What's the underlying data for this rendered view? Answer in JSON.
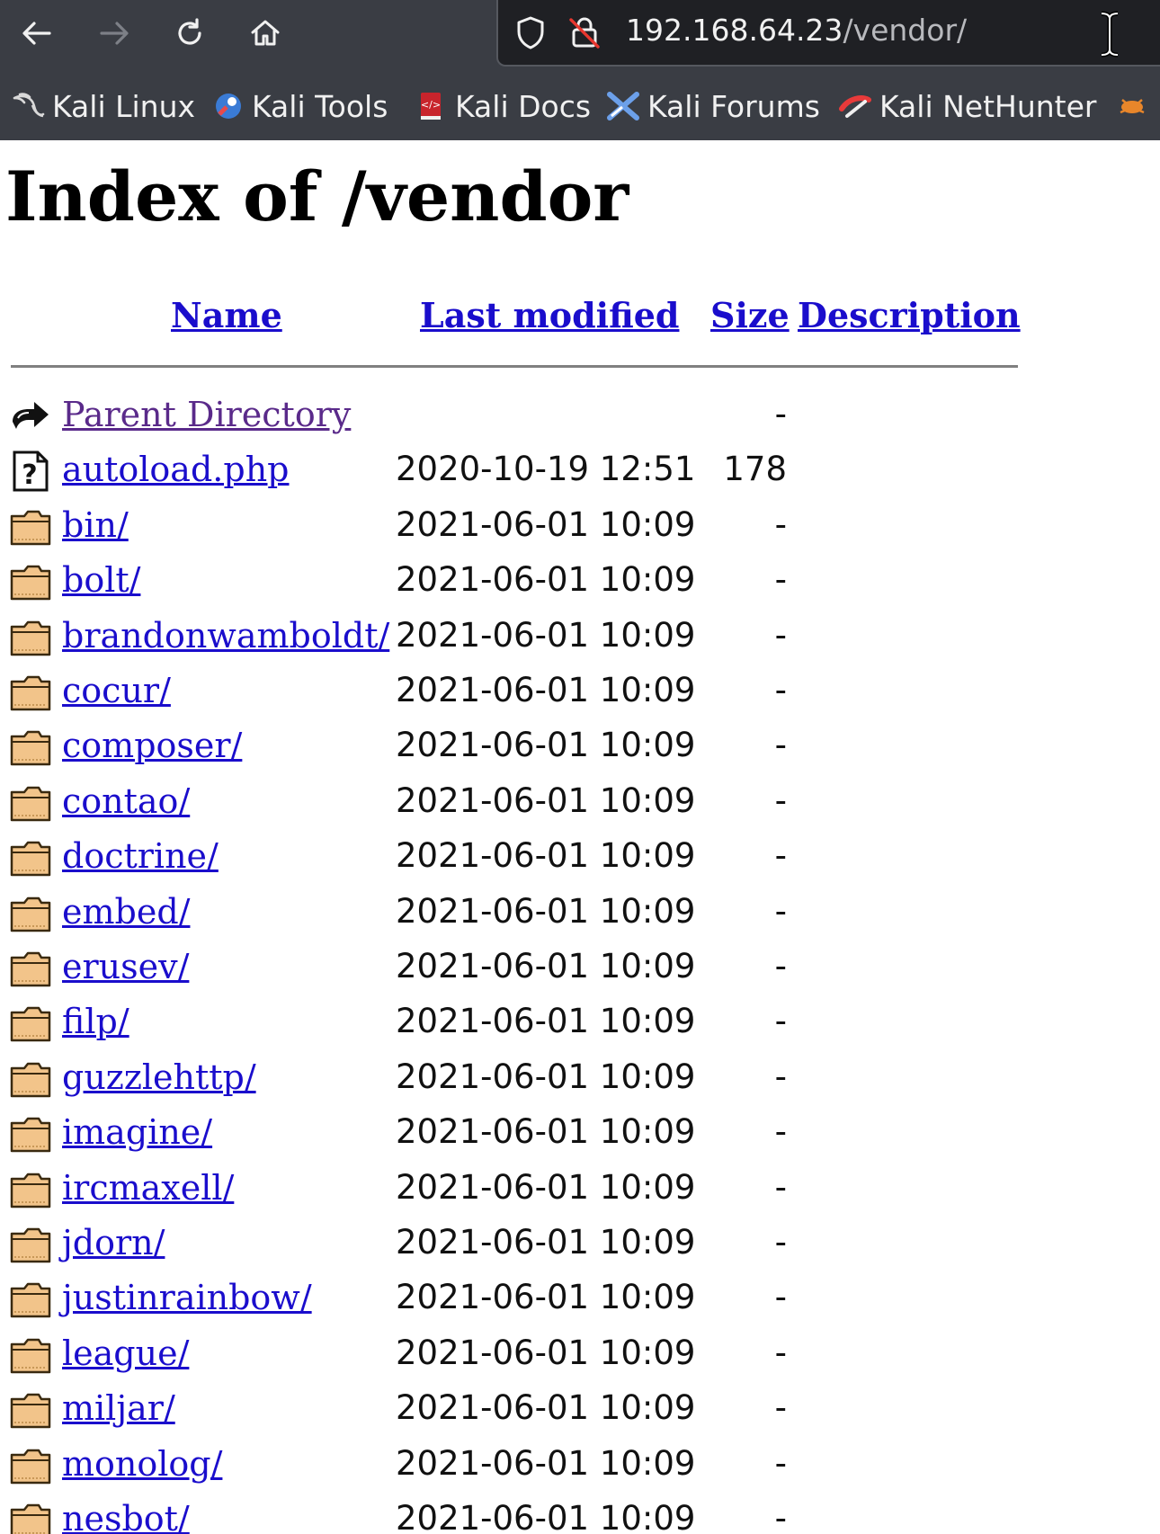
{
  "browser": {
    "url_host": "192.168.64.23",
    "url_path": "/vendor/",
    "icons": {
      "back": "arrow-left-icon",
      "forward": "arrow-right-icon",
      "reload": "reload-icon",
      "home": "home-icon",
      "shield": "shield-icon",
      "lock": "insecure-lock-icon"
    },
    "bookmarks": [
      {
        "label": "Kali Linux",
        "icon": "kali-dragon-icon"
      },
      {
        "label": "Kali Tools",
        "icon": "kali-tools-icon"
      },
      {
        "label": "Kali Docs",
        "icon": "kali-docs-icon"
      },
      {
        "label": "Kali Forums",
        "icon": "kali-forums-icon"
      },
      {
        "label": "Kali NetHunter",
        "icon": "kali-nethunter-icon"
      }
    ]
  },
  "page": {
    "title": "Index of /vendor",
    "columns": {
      "name": "Name",
      "last_modified": "Last modified",
      "size": "Size",
      "description": "Description"
    },
    "entries": [
      {
        "name": "Parent Directory",
        "date": "",
        "size": "-",
        "type": "parent"
      },
      {
        "name": "autoload.php",
        "date": "2020-10-19 12:51",
        "size": "178",
        "type": "file"
      },
      {
        "name": "bin/",
        "date": "2021-06-01 10:09",
        "size": "-",
        "type": "folder"
      },
      {
        "name": "bolt/",
        "date": "2021-06-01 10:09",
        "size": "-",
        "type": "folder"
      },
      {
        "name": "brandonwamboldt/",
        "date": "2021-06-01 10:09",
        "size": "-",
        "type": "folder"
      },
      {
        "name": "cocur/",
        "date": "2021-06-01 10:09",
        "size": "-",
        "type": "folder"
      },
      {
        "name": "composer/",
        "date": "2021-06-01 10:09",
        "size": "-",
        "type": "folder"
      },
      {
        "name": "contao/",
        "date": "2021-06-01 10:09",
        "size": "-",
        "type": "folder"
      },
      {
        "name": "doctrine/",
        "date": "2021-06-01 10:09",
        "size": "-",
        "type": "folder"
      },
      {
        "name": "embed/",
        "date": "2021-06-01 10:09",
        "size": "-",
        "type": "folder"
      },
      {
        "name": "erusev/",
        "date": "2021-06-01 10:09",
        "size": "-",
        "type": "folder"
      },
      {
        "name": "filp/",
        "date": "2021-06-01 10:09",
        "size": "-",
        "type": "folder"
      },
      {
        "name": "guzzlehttp/",
        "date": "2021-06-01 10:09",
        "size": "-",
        "type": "folder"
      },
      {
        "name": "imagine/",
        "date": "2021-06-01 10:09",
        "size": "-",
        "type": "folder"
      },
      {
        "name": "ircmaxell/",
        "date": "2021-06-01 10:09",
        "size": "-",
        "type": "folder"
      },
      {
        "name": "jdorn/",
        "date": "2021-06-01 10:09",
        "size": "-",
        "type": "folder"
      },
      {
        "name": "justinrainbow/",
        "date": "2021-06-01 10:09",
        "size": "-",
        "type": "folder"
      },
      {
        "name": "league/",
        "date": "2021-06-01 10:09",
        "size": "-",
        "type": "folder"
      },
      {
        "name": "miljar/",
        "date": "2021-06-01 10:09",
        "size": "-",
        "type": "folder"
      },
      {
        "name": "monolog/",
        "date": "2021-06-01 10:09",
        "size": "-",
        "type": "folder"
      },
      {
        "name": "nesbot/",
        "date": "2021-06-01 10:09",
        "size": "-",
        "type": "folder"
      }
    ]
  },
  "colors": {
    "link": "#1a0dcc",
    "visited": "#5a2a8a",
    "chrome": "#3a3d44",
    "urlbar": "#1f2024",
    "folder_fill": "#f2c48a"
  }
}
